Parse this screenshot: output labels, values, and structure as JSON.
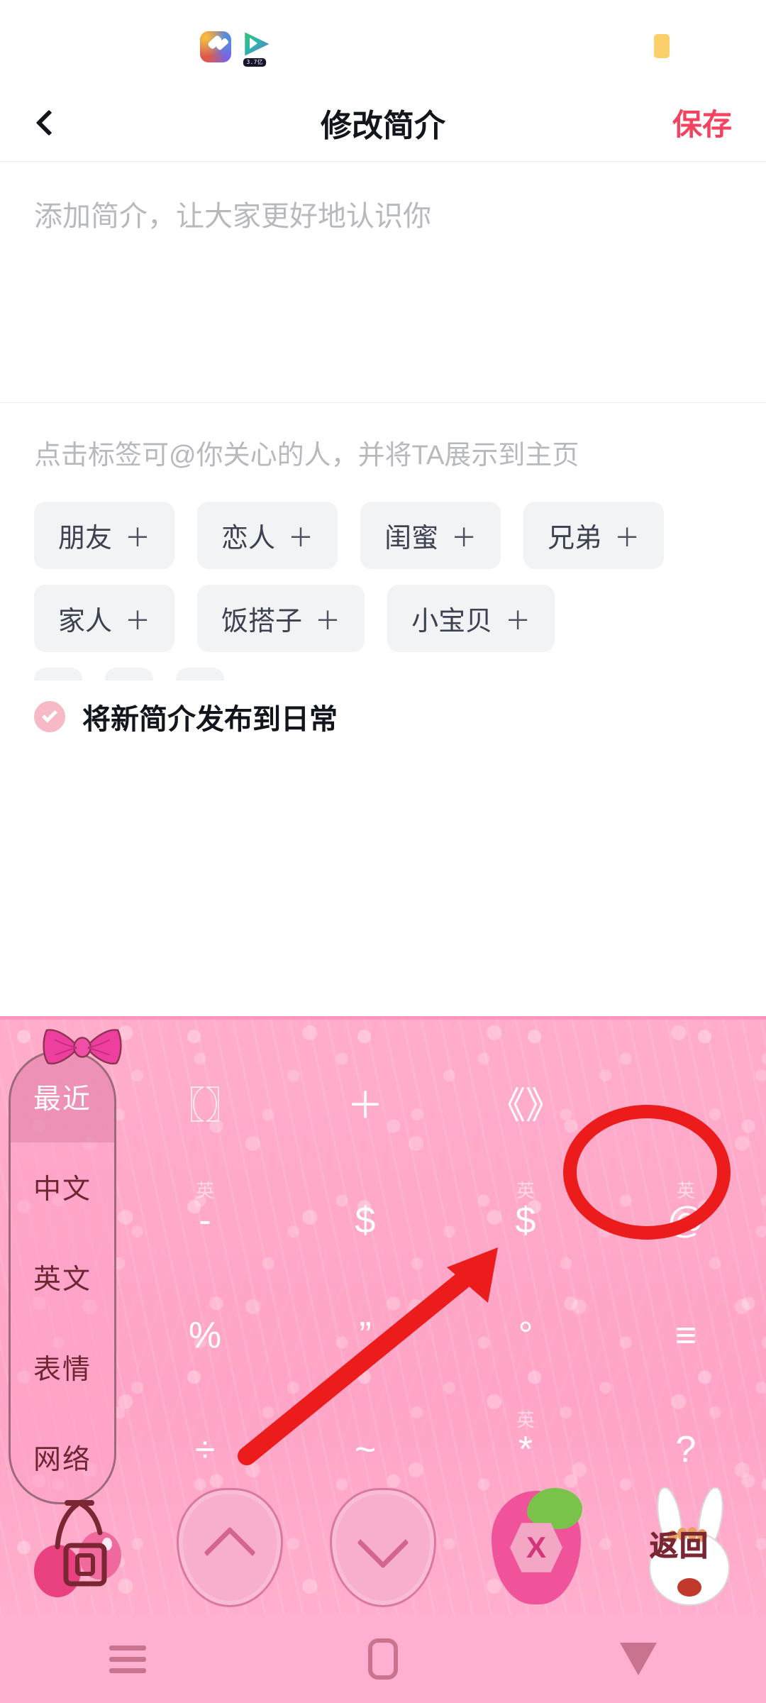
{
  "statusbar": {
    "left_icons": [
      {
        "name": "gradient-app-icon",
        "badge": ""
      },
      {
        "name": "video-player-app-icon",
        "badge": "3.7亿"
      }
    ],
    "right_indicator": "battery-indicator"
  },
  "header": {
    "back_icon": "chevron-left-icon",
    "title": "修改简介",
    "save_label": "保存",
    "save_color": "#f34360"
  },
  "bio": {
    "value": "",
    "placeholder": "添加简介，让大家更好地认识你"
  },
  "tags": {
    "hint": "点击标签可@你关心的人，并将TA展示到主页",
    "plus": "＋",
    "rows": [
      [
        "朋友",
        "恋人",
        "闺蜜",
        "兄弟"
      ],
      [
        "家人",
        "饭搭子",
        "小宝贝"
      ]
    ]
  },
  "publish": {
    "checked": true,
    "label": "将新简介发布到日常",
    "check_color": "#f7b9c6"
  },
  "keyboard": {
    "theme_color": "#ffa8c8",
    "rail": {
      "decoration": "pink-bow-icon",
      "items": [
        {
          "label": "最近",
          "active": true
        },
        {
          "label": "中文",
          "active": false
        },
        {
          "label": "英文",
          "active": false
        },
        {
          "label": "表情",
          "active": false
        },
        {
          "label": "网络",
          "active": false
        }
      ]
    },
    "keys": [
      {
        "glyph": "〖〗",
        "hint": ""
      },
      {
        "glyph": "＋",
        "hint": ""
      },
      {
        "glyph": "《》",
        "hint": ""
      },
      {
        "glyph": "，",
        "hint": ""
      },
      {
        "glyph": "-",
        "hint": "英"
      },
      {
        "glyph": "$",
        "hint": ""
      },
      {
        "glyph": "$",
        "hint": "英"
      },
      {
        "glyph": "@",
        "hint": "英"
      },
      {
        "glyph": "%",
        "hint": ""
      },
      {
        "glyph": "”",
        "hint": ""
      },
      {
        "glyph": "°",
        "hint": ""
      },
      {
        "glyph": "≡",
        "hint": ""
      },
      {
        "glyph": "÷",
        "hint": ""
      },
      {
        "glyph": "~",
        "hint": ""
      },
      {
        "glyph": "*",
        "hint": "英"
      },
      {
        "glyph": "?",
        "hint": ""
      }
    ],
    "function_row": [
      {
        "name": "keyboard-switch-key",
        "icon": "cherry-icon",
        "label": "回"
      },
      {
        "name": "page-up-key",
        "icon": "chevron-up-icon",
        "label": ""
      },
      {
        "name": "page-down-key",
        "icon": "chevron-down-icon",
        "label": ""
      },
      {
        "name": "delete-key",
        "icon": "strawberry-icon",
        "label": "X"
      },
      {
        "name": "return-key",
        "icon": "rabbit-icon",
        "label": "返回"
      }
    ]
  },
  "annotation": {
    "color": "#ec1c1c",
    "circle_target": "@",
    "arrow": "arrow-pointing-to-at-key"
  },
  "navbar": {
    "items": [
      {
        "name": "recents",
        "icon": "menu-icon"
      },
      {
        "name": "home",
        "icon": "home-square-icon"
      },
      {
        "name": "back",
        "icon": "triangle-down-icon"
      }
    ]
  }
}
